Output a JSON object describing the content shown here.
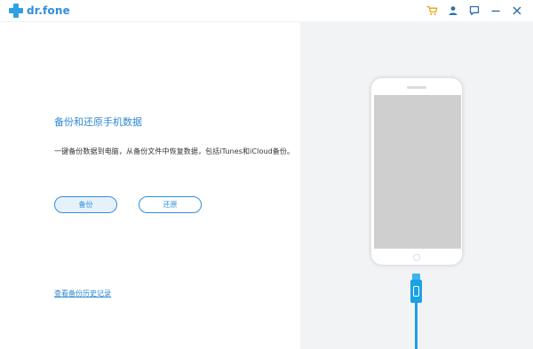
{
  "app": {
    "name": "dr.fone",
    "brand_color": "#2f8ede"
  },
  "titlebar": {
    "icons": [
      "cart-icon",
      "user-icon",
      "feedback-icon",
      "minimize-icon",
      "close-icon"
    ]
  },
  "main": {
    "title": "备份和还原手机数据",
    "description": "一键备份数据到电脑，从备份文件中恢复数据，包括iTunes和iCloud备份。",
    "backup_button": "备份",
    "restore_button": "还原",
    "history_link": "查看备份历史记录"
  },
  "colors": {
    "accent": "#2f8ede",
    "cart_icon": "#e8a317",
    "illustration_bg": "#f2f3f5",
    "cable": "#1aa1e6"
  }
}
